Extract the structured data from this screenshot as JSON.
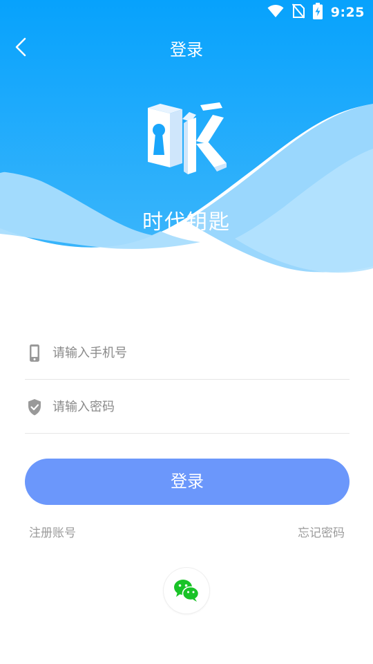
{
  "status_bar": {
    "time": "9:25",
    "icons": [
      "wifi-icon",
      "no-sim-icon",
      "battery-charging-icon"
    ]
  },
  "header": {
    "title": "登录",
    "back_icon": "chevron-left-icon"
  },
  "brand": {
    "logo": "ok-key-logo",
    "app_name": "时代钥匙"
  },
  "form": {
    "phone": {
      "placeholder": "请输入手机号",
      "value": "",
      "icon": "phone-icon"
    },
    "password": {
      "placeholder": "请输入密码",
      "value": "",
      "icon": "shield-check-icon"
    },
    "login_label": "登录"
  },
  "links": {
    "register": "注册账号",
    "forgot_password": "忘记密码"
  },
  "social": {
    "wechat_icon": "wechat-icon"
  },
  "colors": {
    "header_gradient_top": "#0aa4fc",
    "header_gradient_bottom": "#32b2fb",
    "wave_light": "#a6dcfd",
    "login_button": "#6b97fb",
    "link_text": "#9b9b9b",
    "wechat_green": "#19c327"
  }
}
